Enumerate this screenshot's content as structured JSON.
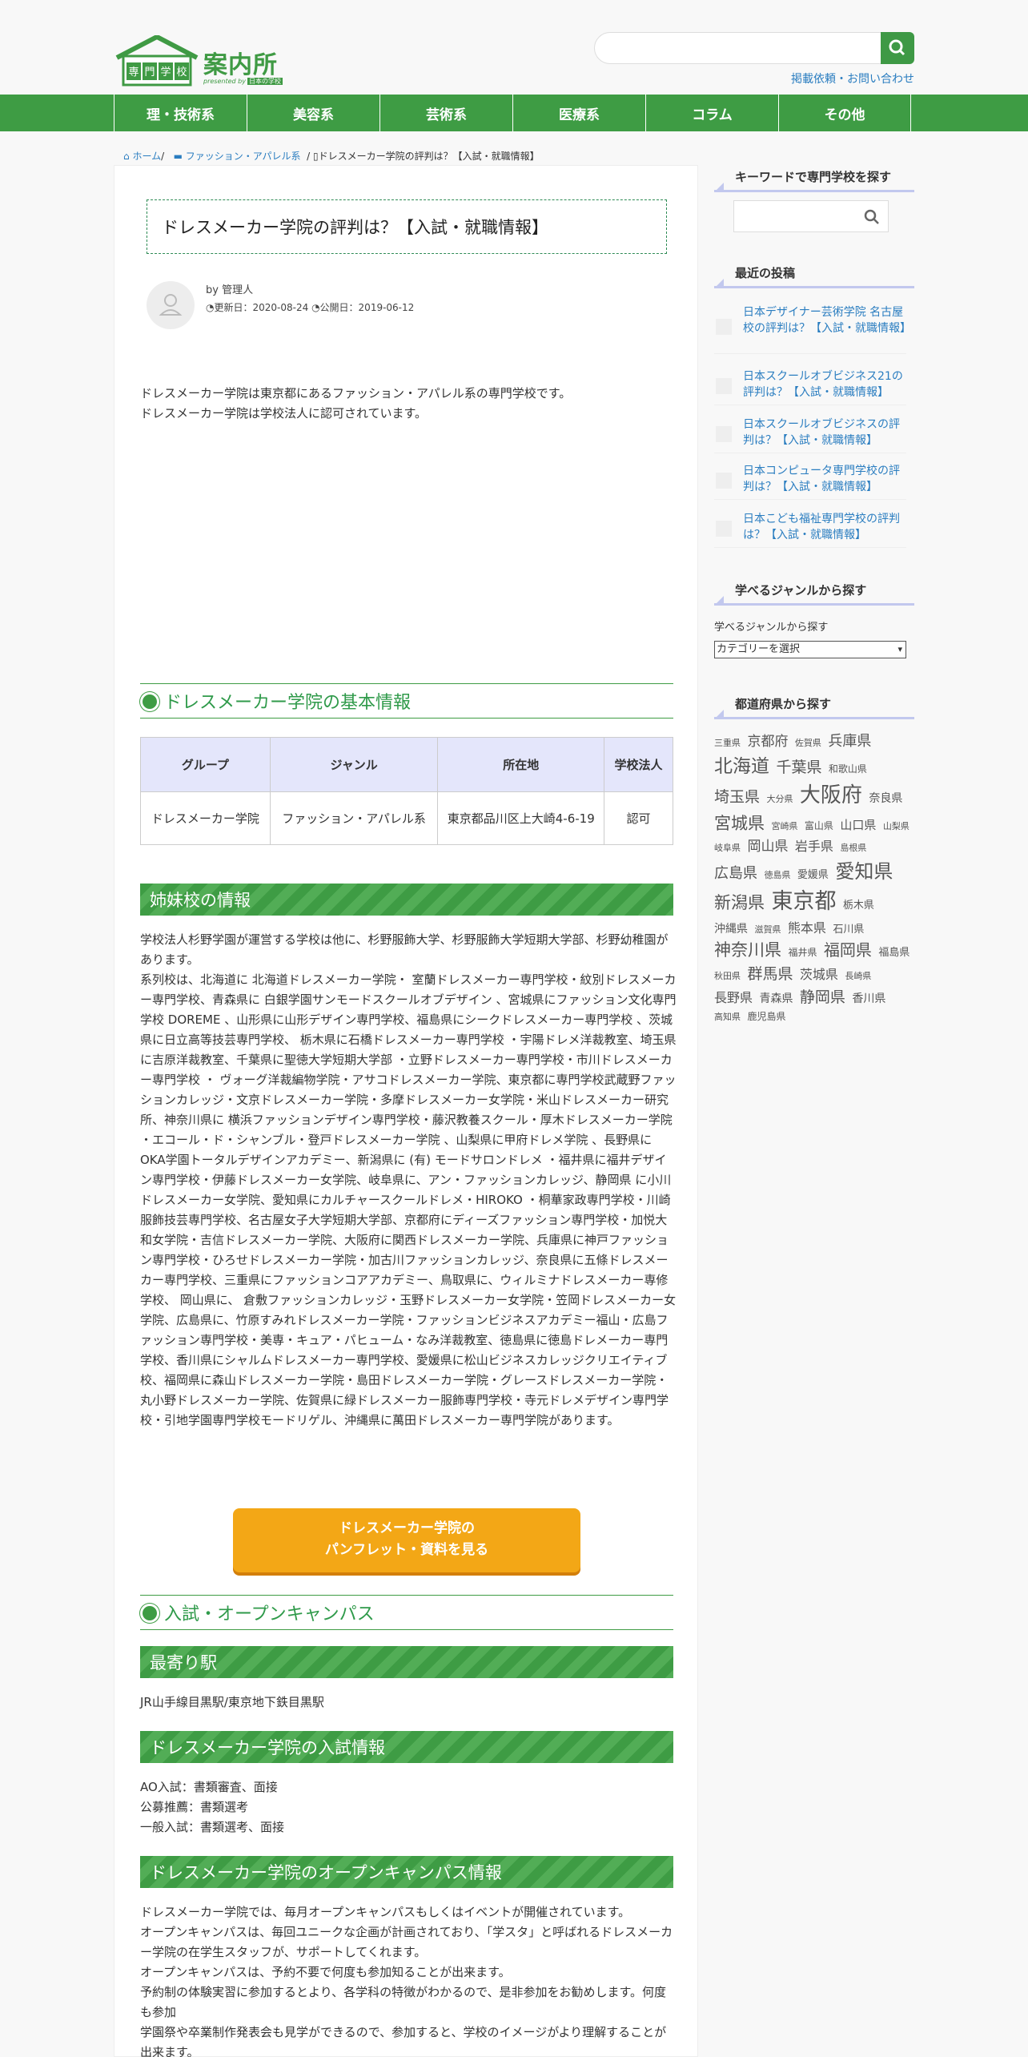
{
  "header": {
    "logo_main": "案内所",
    "logo_house_text": "専門学校",
    "logo_sub": "presented by",
    "logo_brand": "日本の学校",
    "contact_link": "掲載依頼・お問い合わせ"
  },
  "nav": [
    "理・技術系",
    "美容系",
    "芸術系",
    "医療系",
    "コラム",
    "その他"
  ],
  "breadcrumb": {
    "home": "ホーム",
    "category": "ファッション・アパレル系",
    "current": "ドレスメーカー学院の評判は？【入試・就職情報】"
  },
  "article": {
    "title": "ドレスメーカー学院の評判は？【入試・就職情報】",
    "author": "by 管理人",
    "updated": "更新日：2020-08-24",
    "published": "公開日：2019-06-12",
    "intro": "ドレスメーカー学院は東京都にあるファッション・アパレル系の専門学校です。\nドレスメーカー学院は学校法人に認可されています。",
    "h2_basic": "ドレスメーカー学院の基本情報",
    "table": {
      "headers": [
        "グループ",
        "ジャンル",
        "所在地",
        "学校法人"
      ],
      "row": [
        "ドレスメーカー学院",
        "ファッション・アパレル系",
        "東京都品川区上大崎4-6-19",
        "認可"
      ]
    },
    "h3_sister": "姉妹校の情報",
    "sister_text": "学校法人杉野学園が運営する学校は他に、杉野服飾大学、杉野服飾大学短期大学部、杉野幼稚園があります。\n系列校は、北海道に 北海道ドレスメーカー学院・ 室蘭ドレスメーカー専門学校・紋別ドレスメーカー専門学校、青森県に 白銀学園サンモードスクールオブデザイン 、宮城県にファッション文化専門学校 DOREME 、山形県に山形デザイン専門学校、福島県にシークドレスメーカー専門学校 、茨城県に日立高等技芸専門学校、 栃木県に石橋ドレスメーカー専門学校 ・宇陽ドレメ洋裁教室、埼玉県に吉原洋裁教室、千葉県に聖徳大学短期大学部 ・立野ドレスメーカー専門学校・市川ドレスメーカー専門学校 ・ ヴォーグ洋裁編物学院・アサコドレスメーカー学院、東京都に専門学校武蔵野ファッションカレッジ・文京ドレスメーカー学院・多摩ドレスメーカー女学院・米山ドレスメーカー研究所、神奈川県に 横浜ファッションデザイン専門学校・藤沢教養スクール・厚木ドレスメーカー学院 ・エコール・ド・シャンブル・登戸ドレスメーカー学院 、山梨県に甲府ドレメ学院 、長野県にOKA学園トータルデザインアカデミー、新潟県に (有) モードサロンドレメ ・福井県に福井デザイン専門学校・伊藤ドレスメーカー女学院、岐阜県に、アン・ファッションカレッジ、静岡県 に小川ドレスメーカー女学院、愛知県にカルチャースクールドレメ・HIROKO ・桐華家政専門学校・川崎服飾技芸専門学校、名古屋女子大学短期大学部、京都府にディーズファッション専門学校・加悦大和女学院・吉信ドレスメーカー学院、大阪府に関西ドレスメーカー学院、兵庫県に神戸ファッション専門学校・ひろせドレスメーカー学院・加古川ファッションカレッジ、奈良県に五條ドレスメーカー専門学校、三重県にファッションコアアカデミー、鳥取県に、ウィルミナドレスメーカー専修学校、 岡山県に、 倉敷ファッションカレッジ・玉野ドレスメーカー女学院・笠岡ドレスメーカー女学院、広島県に、竹原すみれドレスメーカー学院・ファッションビジネスアカデミー福山・広島ファッション専門学校・美専・キュア・パヒューム・なみ洋裁教室、徳島県に徳島ドレメーカー専門学校、香川県にシャルムドレスメーカー専門学校、愛媛県に松山ビジネスカレッジクリエイティブ校、福岡県に森山ドレスメーカー学院・島田ドレスメーカー学院・グレースドレスメーカー学院・丸小野ドレスメーカー学院、佐賀県に緑ドレスメーカー服飾専門学校・寺元ドレメデザイン専門学校・引地学園専門学校モードリゲル、沖縄県に萬田ドレスメーカー専門学院があります。",
    "cta_line1": "ドレスメーカー学院の",
    "cta_line2": "パンフレット・資料を見る",
    "h2_admission": "入試・オープンキャンパス",
    "h3_station": "最寄り駅",
    "station_text": "JR山手線目黒駅/東京地下鉄目黒駅",
    "h3_exam": "ドレスメーカー学院の入試情報",
    "exam_text": "AO入試：書類審査、面接\n公募推薦：書類選考\n一般入試：書類選考、面接",
    "h3_open": "ドレスメーカー学院のオープンキャンパス情報",
    "open_text": "ドレスメーカー学院では、毎月オープンキャンパスもしくはイベントが開催されています。\nオープンキャンパスは、毎回ユニークな企画が計画されており、「学スタ」と呼ばれるドレスメーカー学院の在学生スタッフが、サポートしてくれます。\nオープンキャンパスは、予約不要で何度も参加知ることが出来ます。\n予約制の体験実習に参加するとより、各学科の特徴がわかるので、是非参加をお勧めします。何度も参加\n学園祭や卒業制作発表会も見学ができるので、参加すると、学校のイメージがより理解することが出来ます。"
  },
  "sidebar": {
    "kw_title": "キーワードで専門学校を探す",
    "recent_title": "最近の投稿",
    "posts": [
      "日本デザイナー芸術学院 名古屋校の評判は？【入試・就職情報】",
      "日本スクールオブビジネス21の評判は？【入試・就職情報】",
      "日本スクールオブビジネスの評判は？【入試・就職情報】",
      "日本コンピュータ専門学校の評判は？【入試・就職情報】",
      "日本こども福祉専門学校の評判は？【入試・就職情報】"
    ],
    "genre_title": "学べるジャンルから探す",
    "genre_label": "学べるジャンルから探す",
    "genre_select": "カテゴリーを選択",
    "pref_title": "都道府県から探す",
    "prefs": [
      [
        "三重県",
        11
      ],
      [
        "京都府",
        17
      ],
      [
        "佐賀県",
        11
      ],
      [
        "兵庫県",
        18
      ],
      [
        "北海道",
        23
      ],
      [
        "千葉県",
        19
      ],
      [
        "和歌山県",
        12
      ],
      [
        "埼玉県",
        19
      ],
      [
        "大分県",
        11
      ],
      [
        "大阪府",
        26
      ],
      [
        "奈良県",
        14
      ],
      [
        "宮城県",
        21
      ],
      [
        "宮崎県",
        11
      ],
      [
        "富山県",
        12
      ],
      [
        "山口県",
        15
      ],
      [
        "山梨県",
        11
      ],
      [
        "岐阜県",
        11
      ],
      [
        "岡山県",
        17
      ],
      [
        "岩手県",
        16
      ],
      [
        "島根県",
        11
      ],
      [
        "広島県",
        18
      ],
      [
        "徳島県",
        11
      ],
      [
        "愛媛県",
        13
      ],
      [
        "愛知県",
        24
      ],
      [
        "新潟県",
        21
      ],
      [
        "東京都",
        27
      ],
      [
        "栃木県",
        13
      ],
      [
        "沖縄県",
        14
      ],
      [
        "滋賀県",
        11
      ],
      [
        "熊本県",
        16
      ],
      [
        "石川県",
        13
      ],
      [
        "神奈川県",
        21
      ],
      [
        "福井県",
        12
      ],
      [
        "福岡県",
        20
      ],
      [
        "福島県",
        13
      ],
      [
        "秋田県",
        11
      ],
      [
        "群馬県",
        19
      ],
      [
        "茨城県",
        16
      ],
      [
        "長崎県",
        11
      ],
      [
        "長野県",
        16
      ],
      [
        "青森県",
        14
      ],
      [
        "静岡県",
        19
      ],
      [
        "香川県",
        14
      ],
      [
        "高知県",
        11
      ],
      [
        "鹿児島県",
        12
      ]
    ]
  }
}
